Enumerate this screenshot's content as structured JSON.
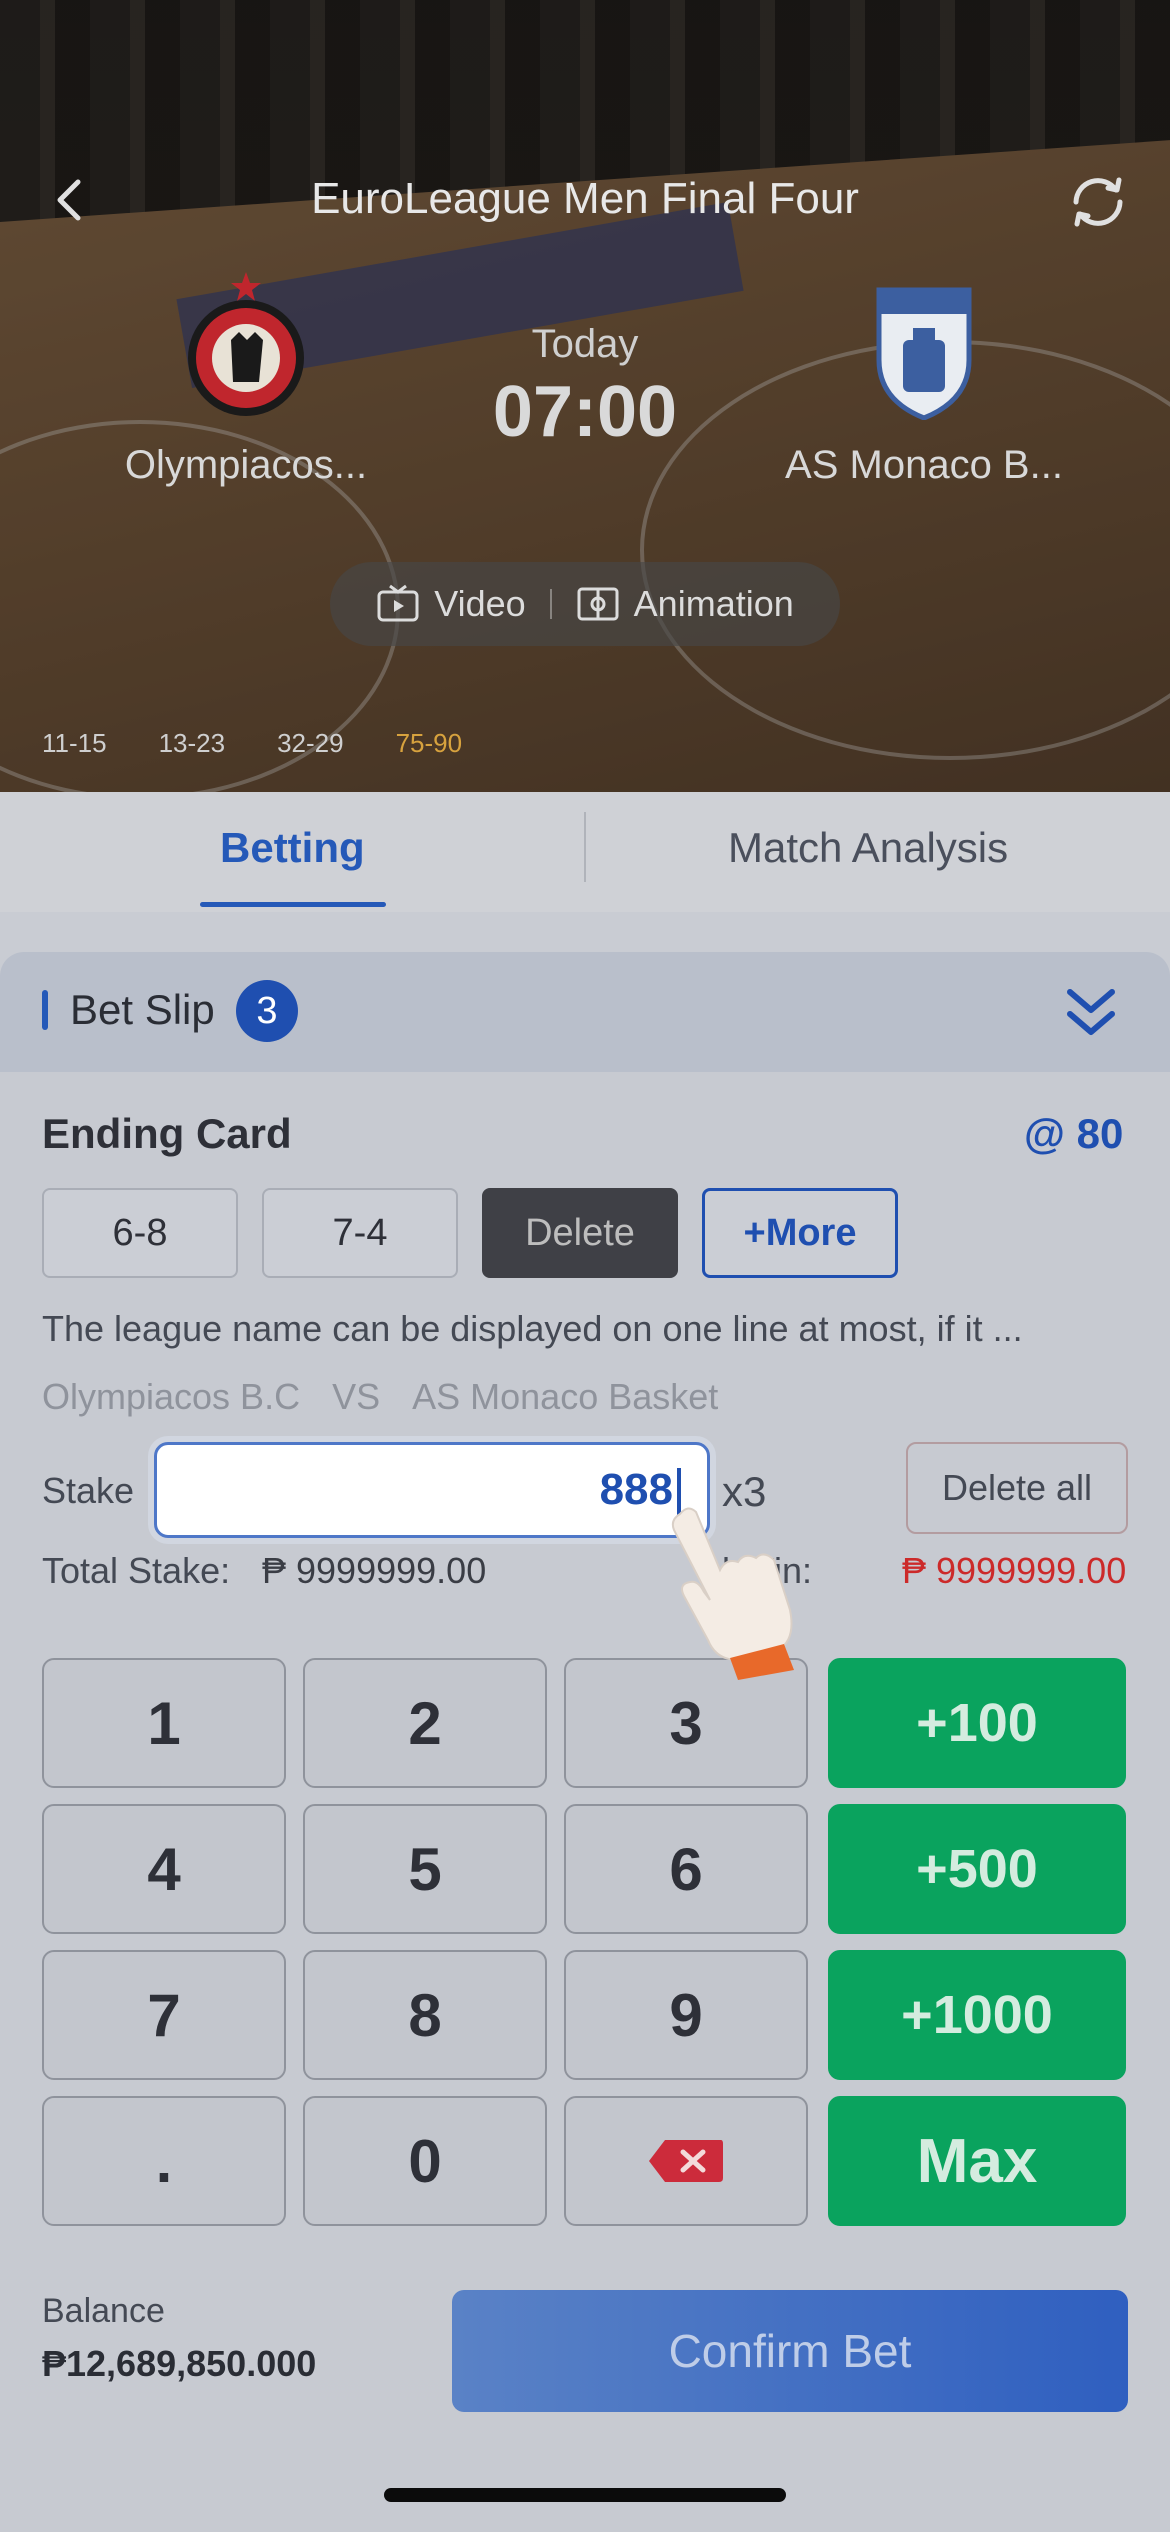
{
  "header": {
    "title": "EuroLeague Men Final Four",
    "home_team": "Olympiacos...",
    "away_team": "AS Monaco B...",
    "day": "Today",
    "time": "07:00",
    "video_label": "Video",
    "animation_label": "Animation",
    "quarters": [
      "11-15",
      "13-23",
      "32-29",
      "75-90"
    ]
  },
  "tabs": {
    "betting": "Betting",
    "analysis": "Match Analysis"
  },
  "slip": {
    "title": "Bet Slip",
    "count": "3",
    "market": "Ending Card",
    "odds": "@ 80",
    "selections": [
      "6-8",
      "7-4"
    ],
    "delete_label": "Delete",
    "more_label": "+More",
    "note": "The league name can be displayed on one line at most, if it ...",
    "home": "Olympiacos B.C",
    "vs": "VS",
    "away": "AS Monaco Basket",
    "stake_label": "Stake",
    "stake_value": "888",
    "multiplier": "x3",
    "delete_all": "Delete all",
    "total_stake_label": "Total Stake:",
    "total_stake_value": "₱ 9999999.00",
    "potential_win_label": "al Win:",
    "potential_win_value": "₱ 9999999.00"
  },
  "keypad": {
    "digits": [
      "1",
      "2",
      "3",
      "4",
      "5",
      "6",
      "7",
      "8",
      "9",
      ".",
      "0"
    ],
    "quick": [
      "+100",
      "+500",
      "+1000",
      "Max"
    ]
  },
  "footer": {
    "balance_label": "Balance",
    "balance_value": "₱12,689,850.000",
    "confirm_label": "Confirm Bet"
  },
  "colors": {
    "accent": "#1f4fb0",
    "green": "#0aa35e",
    "win": "#cc2a2a",
    "quarter_highlight": "#d7a23e"
  }
}
